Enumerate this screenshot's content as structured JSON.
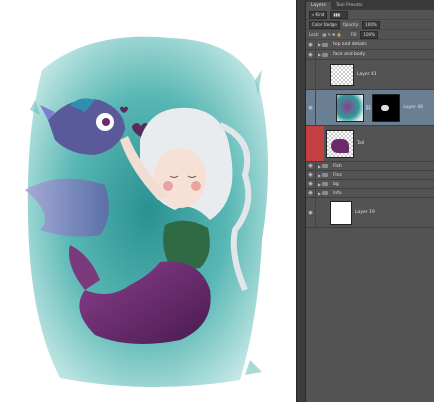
{
  "tabs": [
    "Layers",
    "Tool Presets"
  ],
  "filter": {
    "kind_label": "Kind"
  },
  "blend": {
    "mode": "Color Dodge",
    "opacity_label": "Opacity:",
    "opacity_value": "100%"
  },
  "lock": {
    "label": "Lock:",
    "fill_label": "Fill:",
    "fill_value": "100%"
  },
  "layers": [
    {
      "name": "top and details",
      "kind": "group"
    },
    {
      "name": "face and body",
      "kind": "group"
    },
    {
      "name": "Layer 41",
      "kind": "layer"
    },
    {
      "name": "Layer 46",
      "kind": "masked"
    },
    {
      "name": "Tail",
      "kind": "selected"
    },
    {
      "name": "Fish",
      "kind": "group"
    },
    {
      "name": "Fins",
      "kind": "group"
    },
    {
      "name": "bg",
      "kind": "group"
    },
    {
      "name": "Info",
      "kind": "group"
    },
    {
      "name": "Layer 19",
      "kind": "white"
    }
  ],
  "colors": {
    "panel": "#535353",
    "selected_row": "#6b7f92",
    "tail_row": "#c44040",
    "teal": "#2f9c9b",
    "purple": "#6a2a6c"
  }
}
